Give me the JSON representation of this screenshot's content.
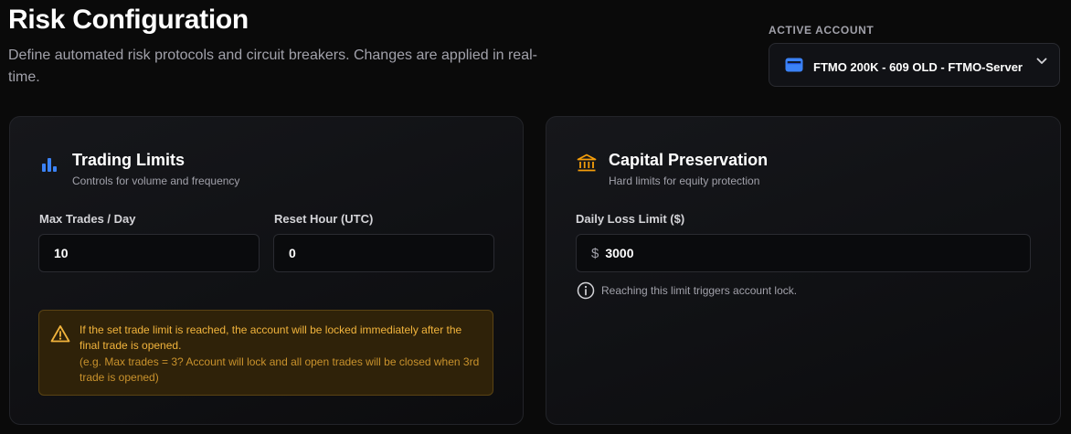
{
  "header": {
    "title": "Risk Configuration",
    "subtitle": "Define automated risk protocols and circuit breakers. Changes are applied in real-time."
  },
  "account": {
    "label": "ACTIVE ACCOUNT",
    "selected": "FTMO 200K - 609 OLD - FTMO-Server",
    "icon": "wallet-icon"
  },
  "trading_limits": {
    "title": "Trading Limits",
    "description": "Controls for volume and frequency",
    "icon": "bar-chart-icon",
    "max_trades": {
      "label": "Max Trades / Day",
      "value": "10"
    },
    "reset_hour": {
      "label": "Reset Hour (UTC)",
      "value": "0"
    },
    "warning": {
      "text": "If the set trade limit is reached, the account will be locked immediately after the final trade is opened.",
      "example": "(e.g. Max trades = 3? Account will lock and all open trades will be closed when 3rd trade is opened)"
    }
  },
  "capital_preservation": {
    "title": "Capital Preservation",
    "description": "Hard limits for equity protection",
    "icon": "bank-icon",
    "daily_loss": {
      "label": "Daily Loss Limit ($)",
      "prefix": "$",
      "value": "3000"
    },
    "info": "Reaching this limit triggers account lock."
  },
  "colors": {
    "accent_blue": "#3b82f6",
    "accent_orange": "#f59e0b",
    "warning_text": "#f2b43c"
  }
}
